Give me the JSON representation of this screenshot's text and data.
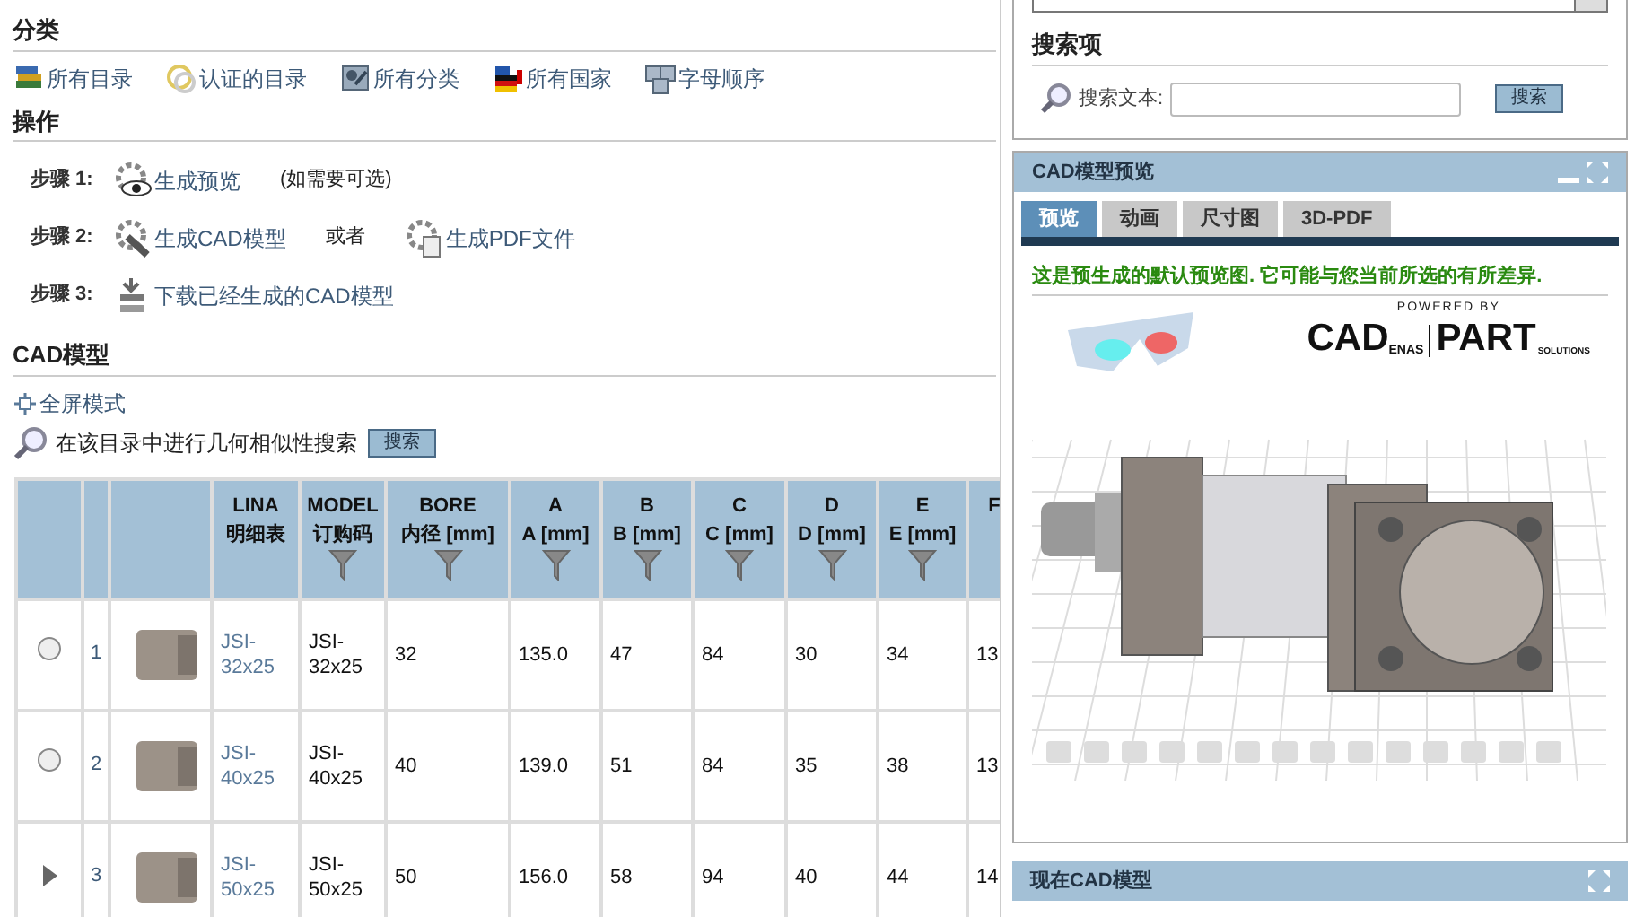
{
  "categories": {
    "title": "分类",
    "links": [
      "所有目录",
      "认证的目录",
      "所有分类",
      "所有国家",
      "字母顺序"
    ]
  },
  "actions": {
    "title": "操作",
    "steps": [
      {
        "label": "步骤 1:",
        "links": [
          "生成预览"
        ],
        "note": "(如需要可选)"
      },
      {
        "label": "步骤 2:",
        "links": [
          "生成CAD模型",
          "生成PDF文件"
        ],
        "connector": "或者"
      },
      {
        "label": "步骤 3:",
        "links": [
          "下载已经生成的CAD模型"
        ]
      }
    ]
  },
  "cad_model": {
    "title": "CAD模型",
    "fullscreen_link": "全屏模式",
    "similarity_search": {
      "label": "在该目录中进行几何相似性搜索",
      "button": "搜索"
    }
  },
  "table": {
    "columns": [
      {
        "lines": [
          "LINA",
          "明细表"
        ],
        "filter": false
      },
      {
        "lines": [
          "MODEL",
          "订购码"
        ],
        "filter": true
      },
      {
        "lines": [
          "BORE",
          "内径 [mm]"
        ],
        "filter": true
      },
      {
        "lines": [
          "A",
          "A [mm]"
        ],
        "filter": true
      },
      {
        "lines": [
          "B",
          "B [mm]"
        ],
        "filter": true
      },
      {
        "lines": [
          "C",
          "C [mm]"
        ],
        "filter": true
      },
      {
        "lines": [
          "D",
          "D [mm]"
        ],
        "filter": true
      },
      {
        "lines": [
          "E",
          "E [mm]"
        ],
        "filter": true
      },
      {
        "lines": [
          "F"
        ],
        "filter": false
      }
    ],
    "rows": [
      {
        "current": false,
        "index": "1",
        "cells": [
          "JSI-32x25",
          "JSI-32x25",
          "32",
          "135.0",
          "47",
          "84",
          "30",
          "34",
          "13"
        ]
      },
      {
        "current": false,
        "index": "2",
        "cells": [
          "JSI-40x25",
          "JSI-40x25",
          "40",
          "139.0",
          "51",
          "84",
          "35",
          "38",
          "13"
        ]
      },
      {
        "current": true,
        "index": "3",
        "cells": [
          "JSI-50x25",
          "JSI-50x25",
          "50",
          "156.0",
          "58",
          "94",
          "40",
          "44",
          "14"
        ]
      }
    ]
  },
  "search_box": {
    "title": "搜索项",
    "label": "搜索文本:",
    "button": "搜索"
  },
  "preview_panel": {
    "title": "CAD模型预览",
    "tabs": [
      {
        "label": "预览",
        "selected": true
      },
      {
        "label": "动画",
        "selected": false
      },
      {
        "label": "尺寸图",
        "selected": false
      },
      {
        "label": "3D-PDF",
        "selected": false
      }
    ],
    "notice": "这是预生成的默认预览图. 它可能与您当前所选的有所差异.",
    "logo": {
      "caption": "POWERED BY",
      "brand": "CAD",
      "brand_sub": "ENAS",
      "product": "PART",
      "product_sub": "SOLUTIONS"
    }
  },
  "current_panel": {
    "title": "现在CAD模型"
  }
}
